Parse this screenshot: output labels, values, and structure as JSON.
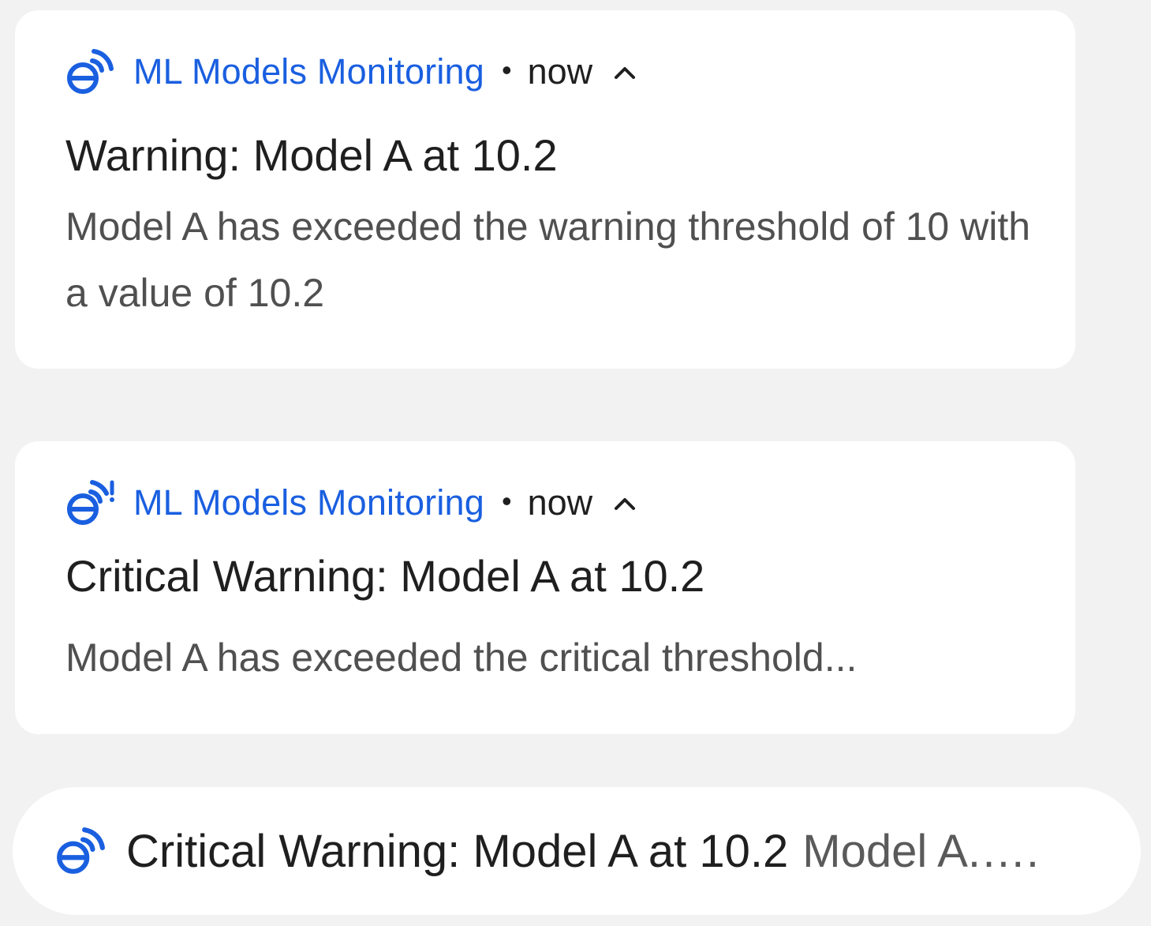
{
  "accent_color": "#1a5fe0",
  "notifications": [
    {
      "app_name": "ML Models Monitoring",
      "separator": "•",
      "time": "now",
      "icon": "monitoring-signal-icon",
      "title": "Warning: Model A at 10.2",
      "body": "Model A has exceeded the warning threshold of 10 with a value of 10.2"
    },
    {
      "app_name": "ML Models Monitoring",
      "separator": "•",
      "time": "now",
      "icon": "monitoring-signal-alert-icon",
      "title": "Critical Warning: Model A at 10.2",
      "body": "Model A has exceeded the critical threshold..."
    }
  ],
  "collapsed_notification": {
    "icon": "monitoring-signal-icon",
    "title": "Critical Warning: Model A at 10.2",
    "body": "Model A.…."
  }
}
